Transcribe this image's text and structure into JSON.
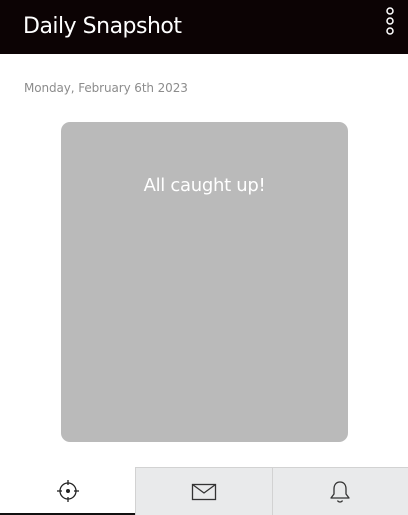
{
  "app_bar": {
    "title": "Daily Snapshot",
    "menu_icon": "more-vertical-icon"
  },
  "date_label": "Monday, February 6th 2023",
  "card": {
    "message": "All caught up!",
    "background": "#bababa"
  },
  "bottom_nav": {
    "tabs": [
      {
        "id": "snapshot",
        "icon": "crosshair-icon",
        "active": true
      },
      {
        "id": "messages",
        "icon": "mail-icon",
        "active": false
      },
      {
        "id": "notifications",
        "icon": "bell-icon",
        "active": false
      }
    ]
  },
  "colors": {
    "app_bar": "#0c0304",
    "nav_inactive": "#e9eaeb",
    "active_indicator": "#111111"
  }
}
